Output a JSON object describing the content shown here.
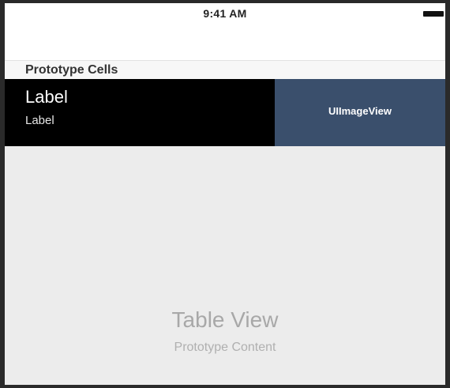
{
  "status_bar": {
    "time": "9:41 AM",
    "battery_icon": "battery-icon"
  },
  "section": {
    "header": "Prototype Cells"
  },
  "cell": {
    "title": "Label",
    "subtitle": "Label",
    "image_view_label": "UIImageView",
    "background_color": "#000000",
    "image_view_color": "#3a4f6c"
  },
  "table_placeholder": {
    "title": "Table View",
    "subtitle": "Prototype Content"
  }
}
